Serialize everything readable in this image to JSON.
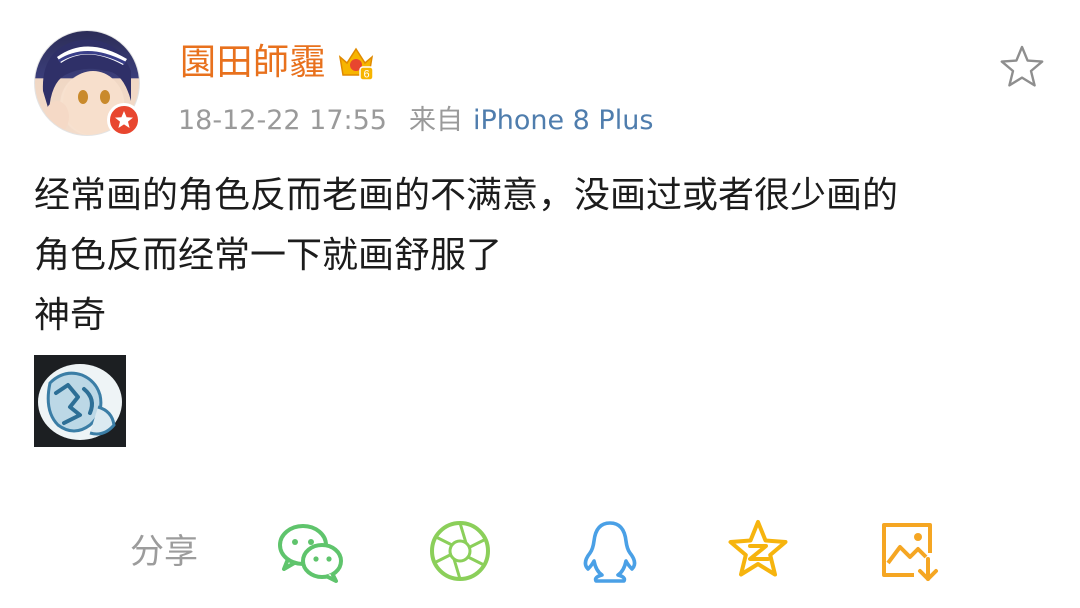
{
  "post": {
    "username": "園田師霾",
    "timestamp": "18-12-22 17:55",
    "source_prefix": "来自",
    "source_device": "iPhone 8 Plus",
    "vip_level": "6",
    "body_lines": [
      "经常画的角色反而老画的不满意，没画过或者很少画的",
      "角色反而经常一下就画舒服了",
      "神奇"
    ]
  },
  "share": {
    "label": "分享",
    "targets": [
      "wechat-icon",
      "moments-icon",
      "qq-icon",
      "qzone-icon",
      "save-image-icon"
    ]
  },
  "colors": {
    "username": "#e8711d",
    "device": "#4f7dad",
    "meta": "#9a9a9a",
    "wechat": "#5fc46c",
    "moments": "#8bcf5a",
    "qq": "#4aa0e6",
    "qzone": "#f6b40e",
    "save": "#f5a623",
    "badge": "#e8462f"
  }
}
